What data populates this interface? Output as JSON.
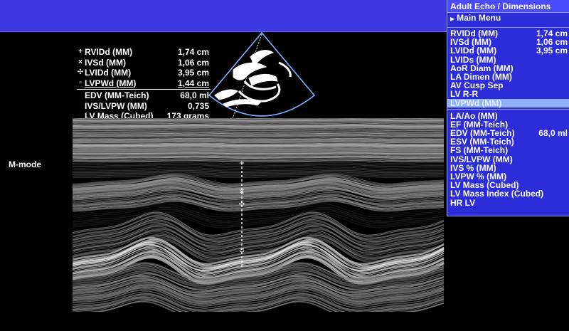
{
  "mode_label": "M-mode",
  "measurements": [
    {
      "marker": "+",
      "label": "RVIDd (MM)",
      "value": "1,74 cm"
    },
    {
      "marker": "×",
      "label": "IVSd (MM)",
      "value": "1,06 cm"
    },
    {
      "marker": "✣",
      "label": "LVIDd (MM)",
      "value": "3,95 cm"
    },
    {
      "marker": "▫",
      "label": "LVPWd (MM)",
      "value": "1,44 cm"
    }
  ],
  "calculations": [
    {
      "label": "EDV (MM-Teich)",
      "value": "68,0 ml"
    },
    {
      "label": "IVS/LVPW (MM)",
      "value": "0,735"
    },
    {
      "label": "LV Mass (Cubed)",
      "value": "173 grams"
    }
  ],
  "menu": {
    "title": "Adult Echo / Dimensions",
    "main_menu": "Main Menu",
    "group1": [
      {
        "label": "RVIDd (MM)",
        "value": "1,74 cm"
      },
      {
        "label": "IVSd (MM)",
        "value": "1,06 cm"
      },
      {
        "label": "LVIDd (MM)",
        "value": "3,95 cm"
      },
      {
        "label": "LVIDs (MM)",
        "value": ""
      },
      {
        "label": "AoR Diam (MM)",
        "value": ""
      },
      {
        "label": "LA Dimen (MM)",
        "value": ""
      },
      {
        "label": "AV Cusp Sep",
        "value": ""
      },
      {
        "label": "LV R-R",
        "value": ""
      },
      {
        "label": "LVPWd (MM)",
        "value": ""
      }
    ],
    "group2": [
      {
        "label": "LA/Ao (MM)",
        "value": ""
      },
      {
        "label": "EF (MM-Teich)",
        "value": ""
      },
      {
        "label": "EDV (MM-Teich)",
        "value": "68,0 ml"
      },
      {
        "label": "ESV (MM-Teich)",
        "value": ""
      },
      {
        "label": "FS (MM-Teich)",
        "value": ""
      },
      {
        "label": "IVS/LVPW (MM)",
        "value": ""
      },
      {
        "label": "IVS % (MM)",
        "value": ""
      },
      {
        "label": "LVPW % (MM)",
        "value": ""
      },
      {
        "label": "LV Mass (Cubed)",
        "value": ""
      },
      {
        "label": "LV Mass Index (Cubed)",
        "value": ""
      },
      {
        "label": "HR LV",
        "value": ""
      }
    ],
    "selected_index": 8
  },
  "colors": {
    "topbar": "#3a3ae0",
    "menu_bg": "#2c2cd8",
    "menu_selected": "#8fb2ff",
    "sector_outline": "#7fb0ff"
  }
}
